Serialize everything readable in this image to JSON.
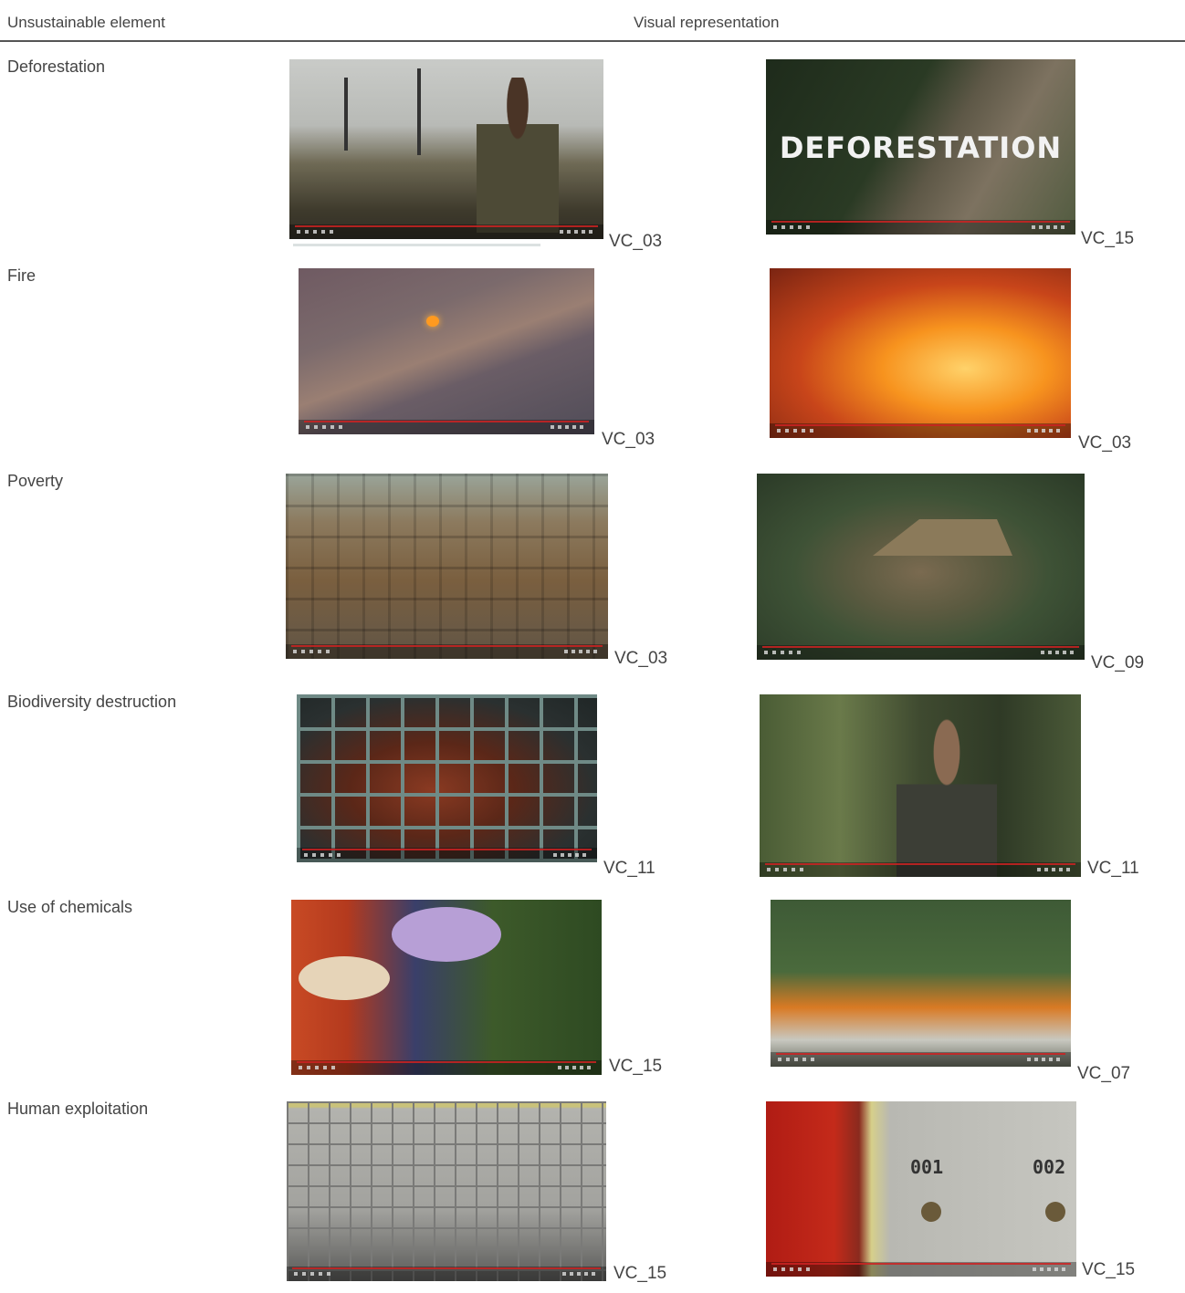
{
  "header": {
    "col1": "Unsustainable element",
    "col2": "Visual representation"
  },
  "rows": [
    {
      "label": "Deforestation",
      "left_code": "VC_03",
      "right_code": "VC_15",
      "right_overlay": "DEFORESTATION"
    },
    {
      "label": "Fire",
      "left_code": "VC_03",
      "right_code": "VC_03"
    },
    {
      "label": "Poverty",
      "left_code": "VC_03",
      "right_code": "VC_09"
    },
    {
      "label": "Biodiversity destruction",
      "left_code": "VC_11",
      "right_code": "VC_11"
    },
    {
      "label": "Use of chemicals",
      "left_code": "VC_15",
      "right_code": "VC_07"
    },
    {
      "label": "Human exploitation",
      "left_code": "VC_15",
      "right_code": "VC_15",
      "right_locker_1": "001",
      "right_locker_2": "002"
    }
  ],
  "colors": {
    "rule": "#555555",
    "progress": "#cc2222"
  }
}
